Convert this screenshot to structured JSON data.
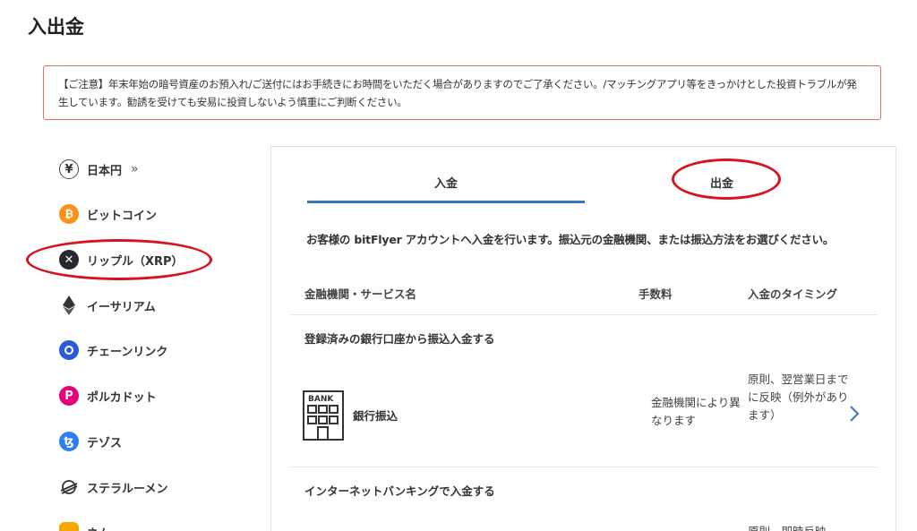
{
  "page": {
    "title": "入出金"
  },
  "notice": {
    "text": "【ご注意】年末年始の暗号資産のお預入れ/ご送付にはお手続きにお時間をいただく場合がありますのでご了承ください。/マッチングアプリ等をきっかけとした投資トラブルが発生しています。勧誘を受けても安易に投資しないよう慎重にご判断ください。",
    "border_color": "#d9735f"
  },
  "sidebar": {
    "items": [
      {
        "label": "日本円",
        "icon": "yen-icon",
        "suffix": "»"
      },
      {
        "label": "ビットコイン",
        "icon": "bitcoin-icon",
        "color": "#f7931a"
      },
      {
        "label": "リップル（XRP）",
        "icon": "xrp-icon",
        "color": "#23292f"
      },
      {
        "label": "イーサリアム",
        "icon": "ethereum-icon",
        "color": "#333333"
      },
      {
        "label": "チェーンリンク",
        "icon": "chainlink-icon",
        "color": "#2a5ada"
      },
      {
        "label": "ポルカドット",
        "icon": "polkadot-icon",
        "color": "#e6007a"
      },
      {
        "label": "テゾス",
        "icon": "tezos-icon",
        "color": "#2c7df7"
      },
      {
        "label": "ステラルーメン",
        "icon": "stellar-icon",
        "color": "#333333"
      },
      {
        "label": "ネム",
        "icon": "nem-icon",
        "color": "#f7a800"
      }
    ]
  },
  "tabs": [
    {
      "label": "入金",
      "active": true
    },
    {
      "label": "出金",
      "active": false
    }
  ],
  "intro": "お客様の bitFlyer アカウントへ入金を行います。振込元の金融機関、または振込方法をお選びください。",
  "table": {
    "headers": [
      "金融機関・サービス名",
      "手数料",
      "入金のタイミング"
    ]
  },
  "sections": [
    {
      "title": "登録済みの銀行口座から振込入金する",
      "rows": [
        {
          "icon": "bank-icon",
          "icon_text": "BANK",
          "name": "銀行振込",
          "fee": "金融機関により異なります",
          "timing": "原則、翌営業日までに反映（例外があります）"
        }
      ]
    },
    {
      "title": "インターネットバンキングで入金する",
      "rows": [
        {
          "timing": "原則、即時反映"
        }
      ]
    }
  ],
  "colors": {
    "accent": "#3a78b8",
    "annotation": "#d9121f"
  }
}
